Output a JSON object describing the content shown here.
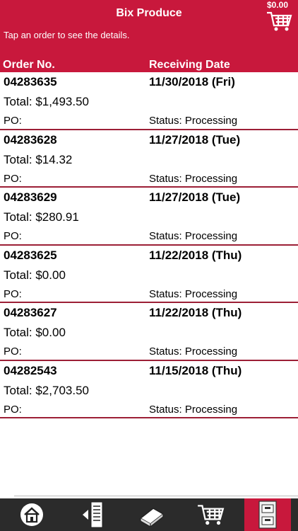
{
  "header": {
    "title": "Bix Produce",
    "cart_total": "$0.00",
    "hint": "Tap an order to see the details.",
    "col_order": "Order No.",
    "col_date": "Receiving Date"
  },
  "orders": [
    {
      "number": "04283635",
      "date": "11/30/2018 (Fri)",
      "total": "Total: $1,493.50",
      "po": "PO:",
      "status": "Status: Processing"
    },
    {
      "number": "04283628",
      "date": "11/27/2018 (Tue)",
      "total": "Total: $14.32",
      "po": "PO:",
      "status": "Status: Processing"
    },
    {
      "number": "04283629",
      "date": "11/27/2018 (Tue)",
      "total": "Total: $280.91",
      "po": "PO:",
      "status": "Status: Processing"
    },
    {
      "number": "04283625",
      "date": "11/22/2018 (Thu)",
      "total": "Total: $0.00",
      "po": "PO:",
      "status": "Status: Processing"
    },
    {
      "number": "04283627",
      "date": "11/22/2018 (Thu)",
      "total": "Total: $0.00",
      "po": "PO:",
      "status": "Status: Processing"
    },
    {
      "number": "04282543",
      "date": "11/15/2018 (Thu)",
      "total": "Total: $2,703.50",
      "po": "PO:",
      "status": "Status: Processing"
    }
  ],
  "tabbar": {
    "items": [
      {
        "icon": "home-icon"
      },
      {
        "icon": "order-list-icon"
      },
      {
        "icon": "catalog-icon"
      },
      {
        "icon": "cart-icon"
      },
      {
        "icon": "order-history-icon",
        "active": true
      }
    ]
  },
  "colors": {
    "brand": "#c8183c",
    "divider": "#9c1f36",
    "tabbar": "#2b2b2b"
  }
}
